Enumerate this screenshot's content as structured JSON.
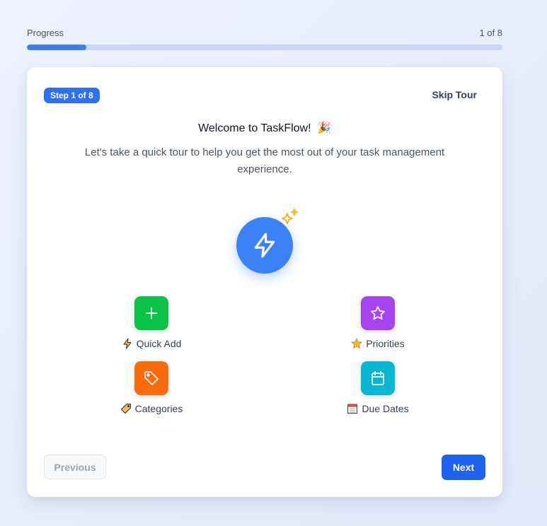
{
  "progress": {
    "label": "Progress",
    "counter": "1 of 8",
    "value": 0.125
  },
  "card": {
    "step_badge": "Step 1 of 8",
    "skip_label": "Skip Tour",
    "title": "Welcome to TaskFlow!",
    "title_emoji": "🎉",
    "subtitle": "Let's take a quick tour to help you get the most out of your task management experience.",
    "hero_icon": "lightning-icon",
    "features": [
      {
        "label": "Quick Add",
        "icon": "plus-icon",
        "mini_icon": "lightning-emoji",
        "color": "#0bc447"
      },
      {
        "label": "Priorities",
        "icon": "star-icon",
        "mini_icon": "star-emoji",
        "color": "#a744f2"
      },
      {
        "label": "Categories",
        "icon": "tag-icon",
        "mini_icon": "tag-emoji",
        "color": "#fb6a0b"
      },
      {
        "label": "Due Dates",
        "icon": "calendar-icon",
        "mini_icon": "calendar-emoji",
        "color": "#09b6d4"
      }
    ],
    "prev_label": "Previous",
    "next_label": "Next"
  },
  "colors": {
    "accent": "#1d63f0",
    "progress_track": "#c7d8fb",
    "progress_fill": "#3b7ff2",
    "hero": "#3b82f6",
    "sparkle": "#f5b41d"
  }
}
